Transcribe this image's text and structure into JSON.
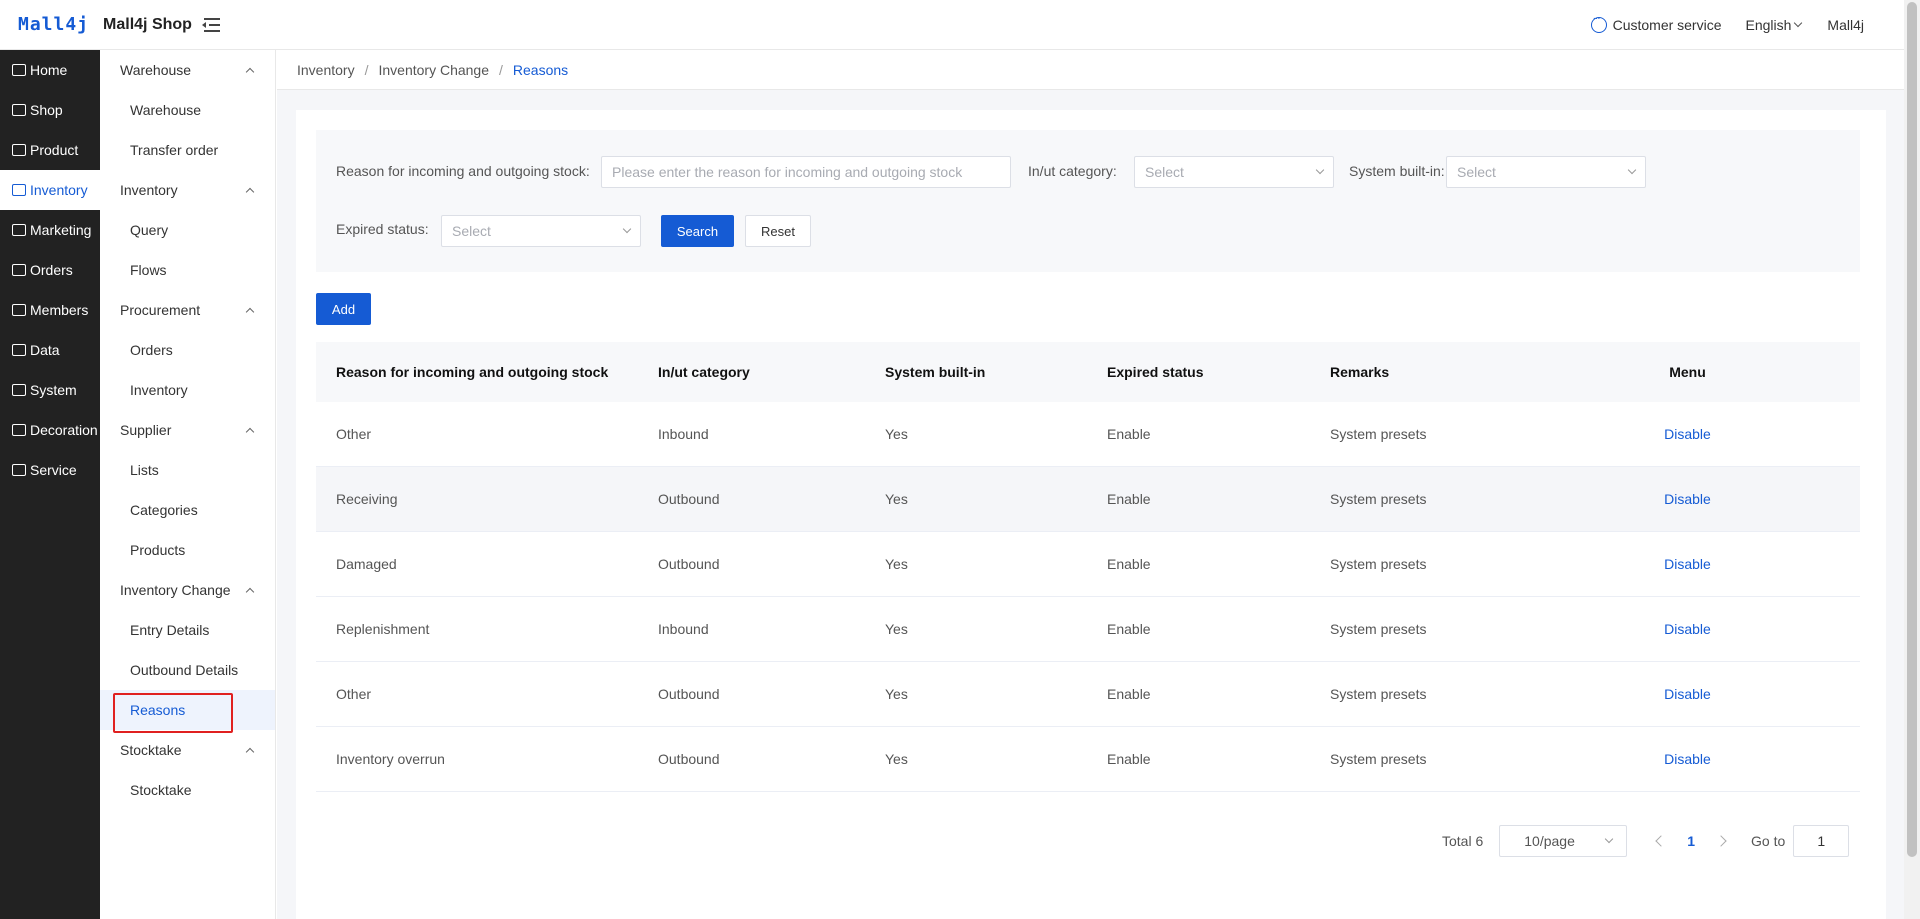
{
  "header": {
    "logo": "Mall4j",
    "shop_name": "Mall4j Shop",
    "customer_service": "Customer service",
    "language": "English",
    "user": "Mall4j"
  },
  "main_nav": [
    {
      "label": "Home",
      "icon": "home-icon"
    },
    {
      "label": "Shop",
      "icon": "shop-icon"
    },
    {
      "label": "Product",
      "icon": "product-icon"
    },
    {
      "label": "Inventory",
      "icon": "inventory-icon",
      "active": true
    },
    {
      "label": "Marketing",
      "icon": "marketing-icon"
    },
    {
      "label": "Orders",
      "icon": "orders-icon"
    },
    {
      "label": "Members",
      "icon": "members-icon"
    },
    {
      "label": "Data",
      "icon": "data-icon"
    },
    {
      "label": "System",
      "icon": "system-icon"
    },
    {
      "label": "Decoration",
      "icon": "decoration-icon"
    },
    {
      "label": "Service",
      "icon": "service-icon"
    }
  ],
  "sub_nav": {
    "g0": "Warehouse",
    "g0_i0": "Warehouse",
    "g0_i1": "Transfer order",
    "g1": "Inventory",
    "g1_i0": "Query",
    "g1_i1": "Flows",
    "g2": "Procurement",
    "g2_i0": "Orders",
    "g2_i1": "Inventory",
    "g3": "Supplier",
    "g3_i0": "Lists",
    "g3_i1": "Categories",
    "g3_i2": "Products",
    "g4": "Inventory Change",
    "g4_i0": "Entry Details",
    "g4_i1": "Outbound Details",
    "g4_i2": "Reasons",
    "g5": "Stocktake",
    "g5_i0": "Stocktake"
  },
  "breadcrumb": [
    "Inventory",
    "Inventory Change",
    "Reasons"
  ],
  "filter": {
    "reason_label": "Reason for incoming and outgoing stock:",
    "reason_placeholder": "Please enter the reason for incoming and outgoing stock",
    "category_label": "In/ut category:",
    "category_value": "Select",
    "builtin_label": "System built-in:",
    "builtin_value": "Select",
    "expired_label": "Expired status:",
    "expired_value": "Select",
    "search_btn": "Search",
    "reset_btn": "Reset"
  },
  "add_btn": "Add",
  "table": {
    "headers": [
      "Reason for incoming and outgoing stock",
      "In/ut category",
      "System built-in",
      "Expired status",
      "Remarks",
      "Menu"
    ],
    "rows": [
      [
        "Other",
        "Inbound",
        "Yes",
        "Enable",
        "System presets",
        "Disable"
      ],
      [
        "Receiving",
        "Outbound",
        "Yes",
        "Enable",
        "System presets",
        "Disable"
      ],
      [
        "Damaged",
        "Outbound",
        "Yes",
        "Enable",
        "System presets",
        "Disable"
      ],
      [
        "Replenishment",
        "Inbound",
        "Yes",
        "Enable",
        "System presets",
        "Disable"
      ],
      [
        "Other",
        "Outbound",
        "Yes",
        "Enable",
        "System presets",
        "Disable"
      ],
      [
        "Inventory overrun",
        "Outbound",
        "Yes",
        "Enable",
        "System presets",
        "Disable"
      ]
    ]
  },
  "pagination": {
    "total": "Total 6",
    "page_size": "10/page",
    "current_page": "1",
    "goto_label": "Go to",
    "goto_value": "1"
  },
  "colors": {
    "primary": "#155bd4",
    "nav_bg": "#222222",
    "highlight": "#e02020"
  }
}
